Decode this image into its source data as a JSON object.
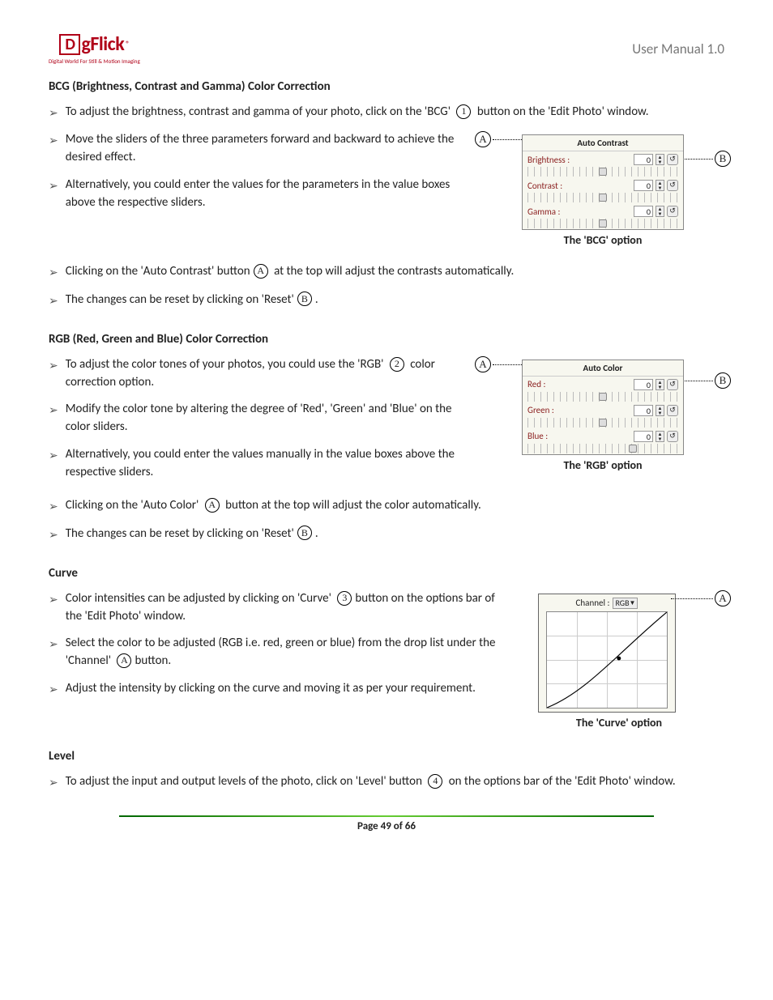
{
  "header": {
    "logo_main": "DgFlick",
    "logo_tag": "Digital World For Still & Motion Imaging",
    "title": "User Manual 1.0"
  },
  "s1": {
    "heading": "BCG (Brightness, Contrast and Gamma) Color Correction",
    "b1a": "To adjust the brightness, contrast and gamma of your photo, click on the 'BCG' ",
    "b1b": " button on the 'Edit Photo' window.",
    "b2": "Move the sliders of the three parameters forward and backward to achieve the desired effect.",
    "b3": "Alternatively, you could enter the values for the parameters in the value boxes above the respective sliders.",
    "b4a": "Clicking on the 'Auto Contrast' button",
    "b4b": " at the top will adjust the contrasts automatically.",
    "b5a": "The changes can be reset by clicking on 'Reset'",
    "b5b": "."
  },
  "panel1": {
    "title": "Auto Contrast",
    "r1": "Brightness :",
    "v1": "0",
    "r2": "Contrast :",
    "v2": "0",
    "r3": "Gamma :",
    "v3": "0",
    "cap": "The 'BCG' option"
  },
  "s2": {
    "heading": "RGB (Red, Green and Blue) Color Correction",
    "b1a": "To adjust the color tones of your photos, you could use the 'RGB' ",
    "b1b": " color correction option.",
    "b2": "Modify the color tone by altering the degree of 'Red', 'Green' and 'Blue' on the color sliders.",
    "b3": "Alternatively, you could enter the values manually in the value boxes above the respective sliders.",
    "b4a": "Clicking on the 'Auto Color' ",
    "b4b": " button at the top will adjust the color automatically.",
    "b5a": "The changes can be reset by clicking on 'Reset'",
    "b5b": "."
  },
  "panel2": {
    "title": "Auto Color",
    "r1": "Red :",
    "v1": "0",
    "r2": "Green :",
    "v2": "0",
    "r3": "Blue :",
    "v3": "0",
    "cap": "The 'RGB' option"
  },
  "s3": {
    "heading": "Curve",
    "b1a": "Color intensities can be adjusted by clicking on 'Curve' ",
    "b1b": "button on the options bar of the 'Edit Photo' window.",
    "b2a": "Select the color to be adjusted (RGB i.e. red, green or blue) from the drop list under the 'Channel' ",
    "b2b": "button.",
    "b3": "Adjust the intensity by clicking on the curve and moving it as per your requirement."
  },
  "panel3": {
    "channel_lbl": "Channel :",
    "channel_val": "RGB",
    "cap": "The 'Curve' option"
  },
  "s4": {
    "heading": "Level",
    "b1a": "To adjust the input and output levels of the photo, click on 'Level' button ",
    "b1b": " on the options bar of the 'Edit Photo' window."
  },
  "footer": {
    "page": "Page 49 of 66"
  },
  "marks": {
    "one": "1",
    "two": "2",
    "three": "3",
    "four": "4",
    "A": "A",
    "B": "B"
  }
}
